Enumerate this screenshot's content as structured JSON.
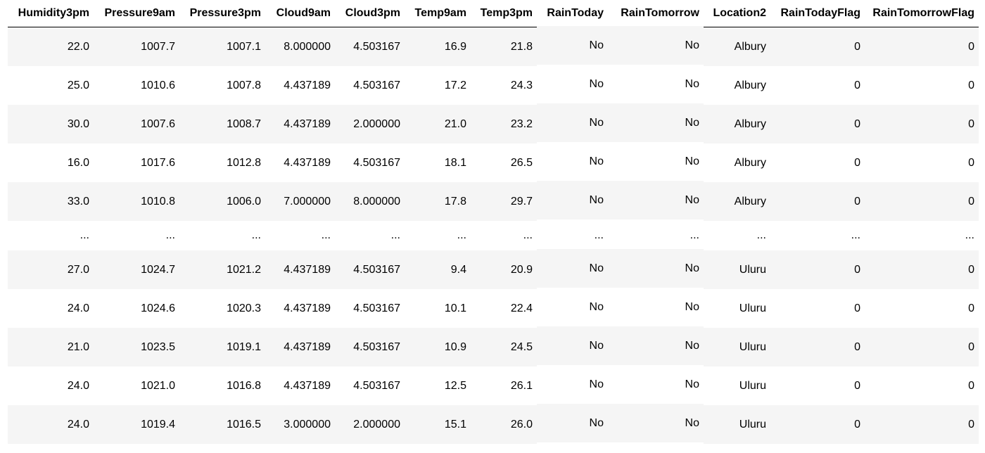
{
  "table": {
    "columns": [
      "Humidity3pm",
      "Pressure9am",
      "Pressure3pm",
      "Cloud9am",
      "Cloud3pm",
      "Temp9am",
      "Temp3pm",
      "RainToday",
      "RainTomorrow",
      "Location2",
      "RainTodayFlag",
      "RainTomorrowFlag"
    ],
    "rows": [
      [
        "22.0",
        "1007.7",
        "1007.1",
        "8.000000",
        "4.503167",
        "16.9",
        "21.8",
        "No",
        "No",
        "Albury",
        "0",
        "0"
      ],
      [
        "25.0",
        "1010.6",
        "1007.8",
        "4.437189",
        "4.503167",
        "17.2",
        "24.3",
        "No",
        "No",
        "Albury",
        "0",
        "0"
      ],
      [
        "30.0",
        "1007.6",
        "1008.7",
        "4.437189",
        "2.000000",
        "21.0",
        "23.2",
        "No",
        "No",
        "Albury",
        "0",
        "0"
      ],
      [
        "16.0",
        "1017.6",
        "1012.8",
        "4.437189",
        "4.503167",
        "18.1",
        "26.5",
        "No",
        "No",
        "Albury",
        "0",
        "0"
      ],
      [
        "33.0",
        "1010.8",
        "1006.0",
        "7.000000",
        "8.000000",
        "17.8",
        "29.7",
        "No",
        "No",
        "Albury",
        "0",
        "0"
      ],
      [
        "...",
        "...",
        "...",
        "...",
        "...",
        "...",
        "...",
        "...",
        "...",
        "...",
        "...",
        "..."
      ],
      [
        "27.0",
        "1024.7",
        "1021.2",
        "4.437189",
        "4.503167",
        "9.4",
        "20.9",
        "No",
        "No",
        "Uluru",
        "0",
        "0"
      ],
      [
        "24.0",
        "1024.6",
        "1020.3",
        "4.437189",
        "4.503167",
        "10.1",
        "22.4",
        "No",
        "No",
        "Uluru",
        "0",
        "0"
      ],
      [
        "21.0",
        "1023.5",
        "1019.1",
        "4.437189",
        "4.503167",
        "10.9",
        "24.5",
        "No",
        "No",
        "Uluru",
        "0",
        "0"
      ],
      [
        "24.0",
        "1021.0",
        "1016.8",
        "4.437189",
        "4.503167",
        "12.5",
        "26.1",
        "No",
        "No",
        "Uluru",
        "0",
        "0"
      ],
      [
        "24.0",
        "1019.4",
        "1016.5",
        "3.000000",
        "2.000000",
        "15.1",
        "26.0",
        "No",
        "No",
        "Uluru",
        "0",
        "0"
      ]
    ]
  }
}
